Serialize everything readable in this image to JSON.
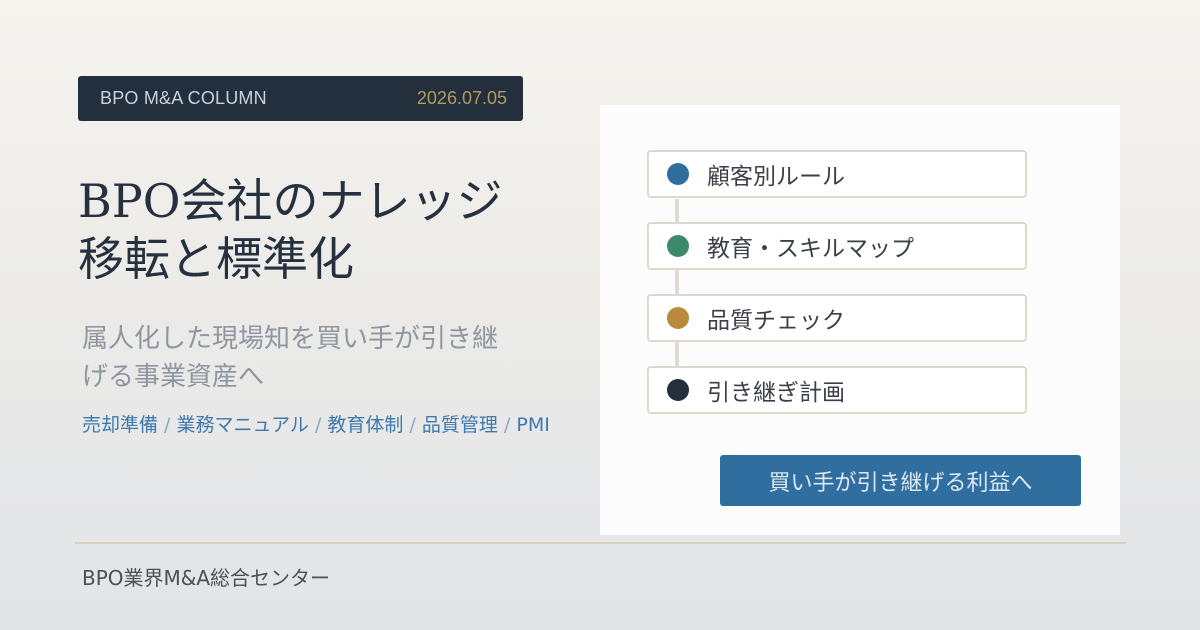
{
  "header": {
    "label": "BPO M&A COLUMN",
    "date": "2026.07.05"
  },
  "title": {
    "line1": "BPO会社のナレッジ",
    "line2": "移転と標準化"
  },
  "subtitle": {
    "line1": "属人化した現場知を買い手が引き継",
    "line2": "げる事業資産へ"
  },
  "tags": [
    "売却準備",
    "業務マニュアル",
    "教育体制",
    "品質管理",
    "PMI"
  ],
  "tag_separator": " / ",
  "steps": [
    {
      "label": "顧客別ルール",
      "color": "#2f6e9f"
    },
    {
      "label": "教育・スキルマップ",
      "color": "#3d8a6b"
    },
    {
      "label": "品質チェック",
      "color": "#b88a3a"
    },
    {
      "label": "引き継ぎ計画",
      "color": "#232f3d"
    }
  ],
  "cta": {
    "label": "買い手が引き継げる利益へ"
  },
  "footer": {
    "organization": "BPO業界M&A総合センター"
  },
  "colors": {
    "dark_navy": "#232f3d",
    "accent_blue": "#2f6e9f",
    "date_gold": "#b39a62"
  }
}
